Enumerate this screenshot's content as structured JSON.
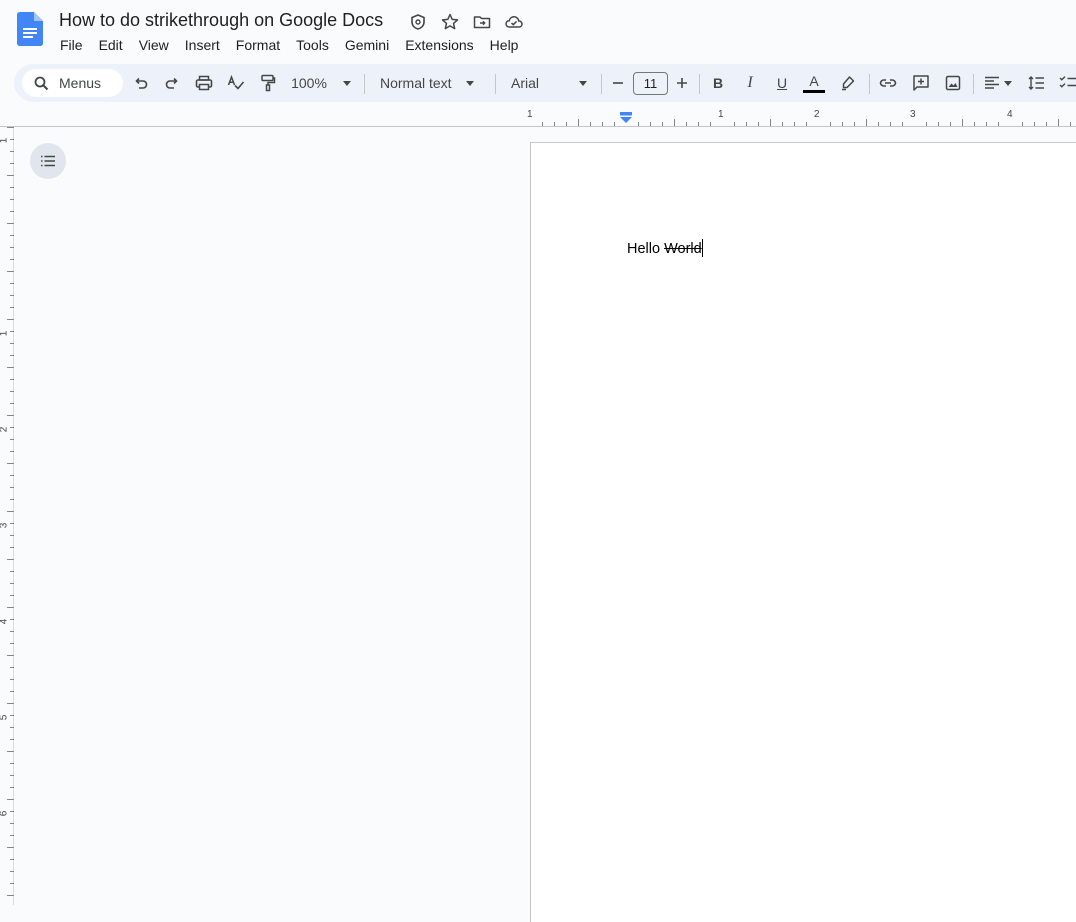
{
  "document": {
    "title": "How to do strikethrough on Google Docs",
    "body": {
      "plain_text": "Hello",
      "strikethrough_text": "World"
    }
  },
  "menubar": {
    "items": [
      {
        "label": "File"
      },
      {
        "label": "Edit"
      },
      {
        "label": "View"
      },
      {
        "label": "Insert"
      },
      {
        "label": "Format"
      },
      {
        "label": "Tools"
      },
      {
        "label": "Gemini"
      },
      {
        "label": "Extensions"
      },
      {
        "label": "Help"
      }
    ]
  },
  "toolbar": {
    "search_label": "Menus",
    "zoom": "100%",
    "paragraph_style": "Normal text",
    "font": "Arial",
    "font_size": "11",
    "text_color": "#000000"
  },
  "ruler": {
    "horizontal_labels": [
      "1",
      "1",
      "2",
      "3",
      "4"
    ],
    "vertical_labels": [
      "1",
      "1",
      "2",
      "3",
      "4",
      "5",
      "6"
    ]
  },
  "colors": {
    "docs_blue": "#4285f4",
    "background": "#f9fbfd",
    "toolbar_bg": "#edf2fa",
    "indent_marker": "#4285f4"
  }
}
